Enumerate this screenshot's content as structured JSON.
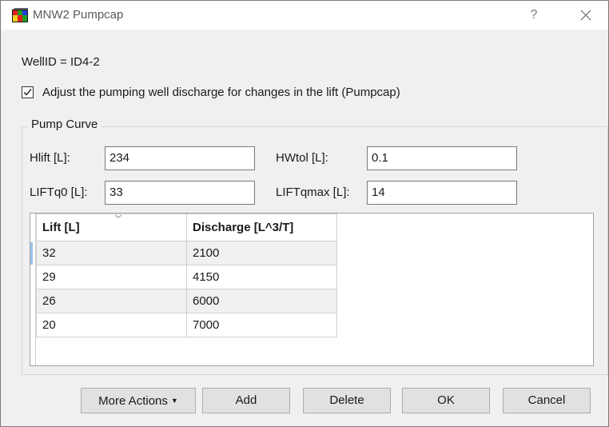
{
  "window": {
    "title": "MNW2 Pumpcap",
    "help_label": "?"
  },
  "well_id_text": "WellID = ID4-2",
  "pumpcap_checkbox": {
    "label": "Adjust the pumping well discharge for changes in the lift (Pumpcap)",
    "checked": true
  },
  "pump_curve": {
    "title": "Pump Curve",
    "fields": {
      "hlift": {
        "label": "Hlift [L]:",
        "value": "234"
      },
      "hwtol": {
        "label": "HWtol [L]:",
        "value": "0.1"
      },
      "liftq0": {
        "label": "LIFTq0 [L]:",
        "value": "33"
      },
      "liftqmax": {
        "label": "LIFTqmax [L]:",
        "value": "14"
      }
    },
    "table": {
      "columns": [
        "Lift [L]",
        "Discharge [L^3/T]"
      ],
      "rows": [
        [
          "32",
          "2100"
        ],
        [
          "29",
          "4150"
        ],
        [
          "26",
          "6000"
        ],
        [
          "20",
          "7000"
        ]
      ]
    }
  },
  "buttons": {
    "more_actions": "More Actions",
    "add": "Add",
    "delete": "Delete",
    "ok": "OK",
    "cancel": "Cancel"
  },
  "colors": {
    "dialog_bg": "#f0f0f0",
    "selection_indicator": "#99c2ec"
  },
  "icons": {
    "app": "mnw2-app-icon",
    "help": "question-mark-icon",
    "close": "close-icon",
    "checkbox": "checkmark-icon",
    "sort": "chevron-down-icon",
    "dropdown": "caret-down-icon"
  }
}
